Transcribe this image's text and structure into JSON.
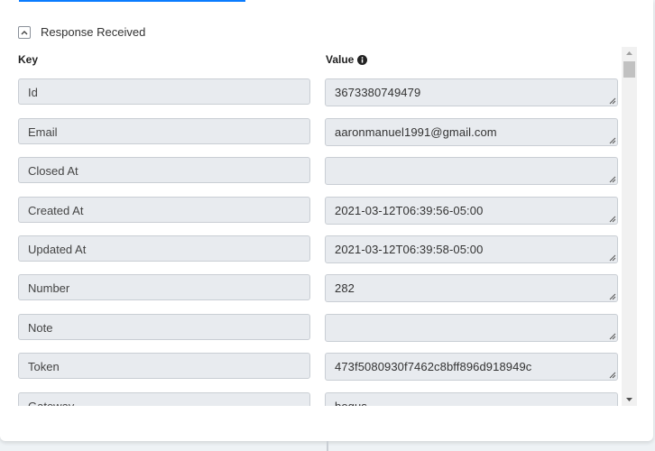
{
  "section": {
    "title": "Response Received",
    "collapse_icon": "chevron-up-icon",
    "expanded": true
  },
  "columns": {
    "key": "Key",
    "value": "Value",
    "value_icon": "info-icon"
  },
  "rows": [
    {
      "key": "Id",
      "value": "3673380749479"
    },
    {
      "key": "Email",
      "value": "aaronmanuel1991@gmail.com"
    },
    {
      "key": "Closed At",
      "value": ""
    },
    {
      "key": "Created At",
      "value": "2021-03-12T06:39:56-05:00"
    },
    {
      "key": "Updated At",
      "value": "2021-03-12T06:39:58-05:00"
    },
    {
      "key": "Number",
      "value": "282"
    },
    {
      "key": "Note",
      "value": ""
    },
    {
      "key": "Token",
      "value": "473f5080930f7462c8bff896d918949c"
    },
    {
      "key": "Gateway",
      "value": "bogus"
    }
  ],
  "colors": {
    "accent": "#0a7cff",
    "field_bg": "#e8ebef",
    "field_border": "#c9ced4"
  }
}
